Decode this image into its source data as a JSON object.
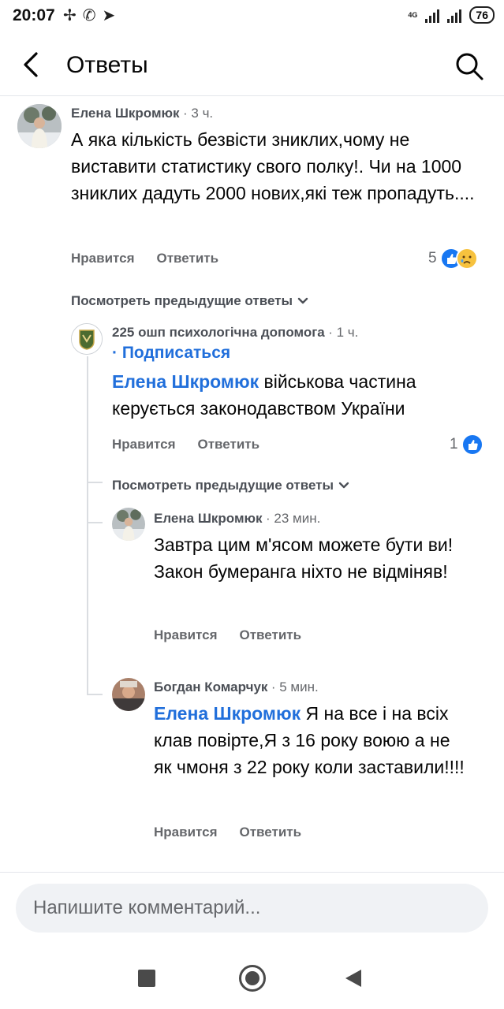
{
  "status": {
    "time": "20:07",
    "battery": "76",
    "net": "4G"
  },
  "header": {
    "title": "Ответы"
  },
  "comment1": {
    "name": "Елена Шкромюк",
    "time": "· 3 ч.",
    "text": "А яка кількість безвісти зниклих,чому не виставити статистику свого полку!. Чи на 1000 зниклих дадуть 2000 нових,які теж пропадуть....",
    "like": "Нравится",
    "reply": "Ответить",
    "reactions": "5"
  },
  "prev_replies_1": "Посмотреть предыдущие ответы",
  "reply1": {
    "name": "225 ошп психологічна допомога",
    "time": "· 1 ч.",
    "follow": "· Подписаться",
    "mention": "Елена Шкромюк",
    "text": " військова частина керується законодавством України",
    "like": "Нравится",
    "reply": "Ответить",
    "reactions": "1"
  },
  "prev_replies_2": "Посмотреть предыдущие ответы",
  "reply2": {
    "name": "Елена Шкромюк",
    "time": "· 23 мин.",
    "text": "Завтра цим м'ясом можете бути ви! Закон бумеранга ніхто не відміняв!",
    "like": "Нравится",
    "reply": "Ответить"
  },
  "reply3": {
    "name": "Богдан Комарчук",
    "time": "· 5 мин.",
    "mention": "Елена Шкромюк",
    "text": " Я на все і на всіх клав повірте,Я з 16 року воюю а не як чмоня з 22 року коли заставили!!!!",
    "like": "Нравится",
    "reply": "Ответить"
  },
  "input": {
    "placeholder": "Напишите комментарий..."
  },
  "colors": {
    "accent": "#1877f2",
    "mention": "#216fdb",
    "muted": "#65676b"
  },
  "icons": [
    "back-arrow-icon",
    "search-icon",
    "like-icon",
    "sad-icon",
    "chevron-down-icon",
    "square-icon",
    "circle-icon",
    "triangle-back-icon"
  ]
}
